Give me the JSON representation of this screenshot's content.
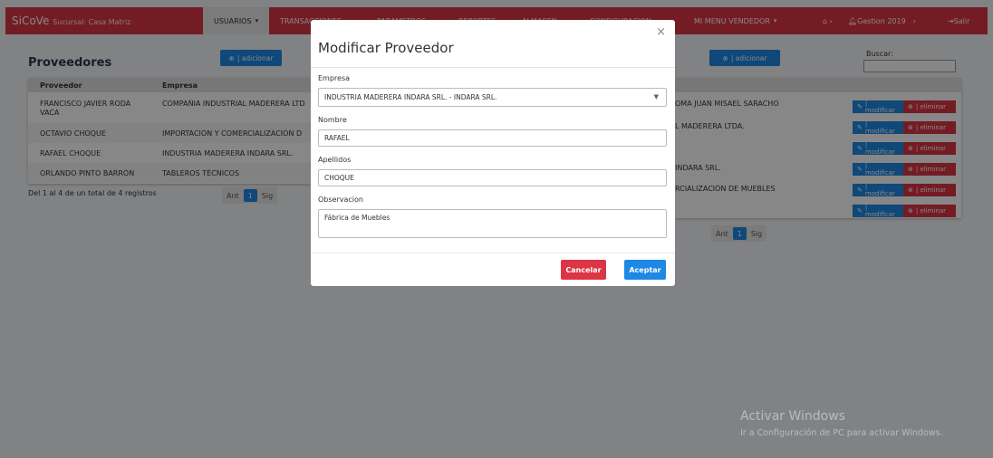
{
  "navbar": {
    "brand": "SiCoVe",
    "branch": "Sucursal: Casa Matriz",
    "items": [
      "USUARIOS",
      "TRANSACCIONES",
      "PARAMETROS",
      "REPORTES",
      "ALMACEN",
      "CONFIGURACION",
      "MI MENU VENDEDOR"
    ],
    "gestion": "Gestion 2019",
    "salir": "Salir"
  },
  "left_panel": {
    "title": "Proveedores",
    "add_label": "| adicionar",
    "columns": [
      "Proveedor",
      "Empresa"
    ],
    "rows": [
      {
        "proveedor": "FRANCISCO JAVIER RODA",
        "proveedor2": "VACA",
        "empresa": "COMPAÑIA INDUSTRIAL MADERERA LTD"
      },
      {
        "proveedor": "OCTAVIO CHOQUE",
        "empresa": "IMPORTACIÓN Y COMERCIALIZACIÓN D"
      },
      {
        "proveedor": "RAFAEL CHOQUE",
        "empresa": "INDUSTRIA MADERERA INDARA SRL."
      },
      {
        "proveedor": "ORLANDO PINTO BARRÓN",
        "empresa": "TABLEROS TÉCNICOS"
      }
    ],
    "footer": "Del 1 al 4 de un total de 4 registros",
    "pager": {
      "prev": "Ant",
      "current": "1",
      "next": "Sig"
    }
  },
  "right_panel": {
    "add_label": "| adicionar",
    "search_label": "Buscar:",
    "search_value": "",
    "rows": [
      "OMA JUAN MISAEL SARACHO",
      "L MADERERA LTDA.",
      "",
      "INDARA SRL.",
      "RCIALIZACIÓN DE MUEBLES",
      ""
    ],
    "modify_label": "| modificar",
    "delete_label": "| eliminar",
    "pager": {
      "prev": "Ant",
      "current": "1",
      "next": "Sig"
    }
  },
  "modal": {
    "title": "Modificar Proveedor",
    "close": "×",
    "fields": {
      "empresa_label": "Empresa",
      "empresa_value": "INDUSTRIA MADERERA INDARA SRL. - INDARA SRL.",
      "nombre_label": "Nombre",
      "nombre_value": "RAFAEL",
      "apellidos_label": "Apellidos",
      "apellidos_value": "CHOQUE",
      "observacion_label": "Observacion",
      "observacion_value": "Fábrica de Muebles"
    },
    "cancel": "Cancelar",
    "accept": "Aceptar"
  },
  "watermark": {
    "line1": "Activar Windows",
    "line2": "Ir a Configuración de PC para activar Windows."
  },
  "colors": {
    "brand_red": "#dc3545",
    "primary_blue": "#1e88e5"
  }
}
